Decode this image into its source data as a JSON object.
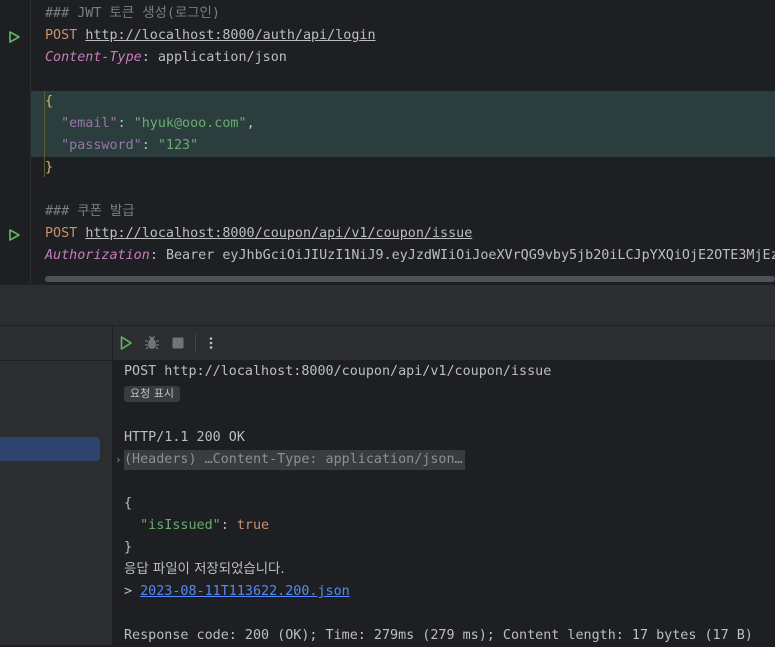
{
  "editor": {
    "lines": {
      "comment1": "### JWT 토큰 생성(로그인)",
      "method1": "POST",
      "url1": "http://localhost:8000/auth/api/login",
      "header1_name": "Content-Type",
      "header1_sep": ": ",
      "header1_value": "application/json",
      "brace_open": "{",
      "email_key": "\"email\"",
      "email_colon": ": ",
      "email_value": "\"hyuk@ooo.com\"",
      "email_comma": ",",
      "password_key": "\"password\"",
      "password_colon": ": ",
      "password_value": "\"123\"",
      "brace_close": "}",
      "comment2": "### 쿠폰 발급",
      "method2": "POST",
      "url2": "http://localhost:8000/coupon/api/v1/coupon/issue",
      "header2_name": "Authorization",
      "header2_sep": ": ",
      "header2_value": "Bearer eyJhbGciOiJIUzI1NiJ9.eyJzdWIiOiJoeXVrQG9vby5jb20iLCJpYXQiOjE2OTE3MjEz"
    },
    "icons": {
      "run1": "run-request-icon",
      "run2": "run-request-icon"
    }
  },
  "toolbar": {
    "run": "run-icon",
    "debug": "debug-icon",
    "stop": "stop-icon",
    "more": "more-vertical-icon"
  },
  "output": {
    "request_line": "POST http://localhost:8000/coupon/api/v1/coupon/issue",
    "show_request_chip": "요청 표시",
    "status_line": "HTTP/1.1 200 OK",
    "headers_fold": "(Headers) …Content-Type: application/json…",
    "json_open": "{",
    "json_key": "\"isIssued\"",
    "json_colon": ": ",
    "json_value": "true",
    "json_close": "}",
    "saved_message": "응답 파일이 저장되었습니다.",
    "saved_prefix": "> ",
    "saved_file": "2023-08-11T113622.200.json",
    "summary": "Response code: 200 (OK); Time: 279ms (279 ms); Content length: 17 bytes (17 B)"
  },
  "colors": {
    "background": "#1e1f22",
    "panel": "#2b2d30",
    "run_green": "#5fb865",
    "selection": "#2e436e",
    "link": "#548af7"
  }
}
